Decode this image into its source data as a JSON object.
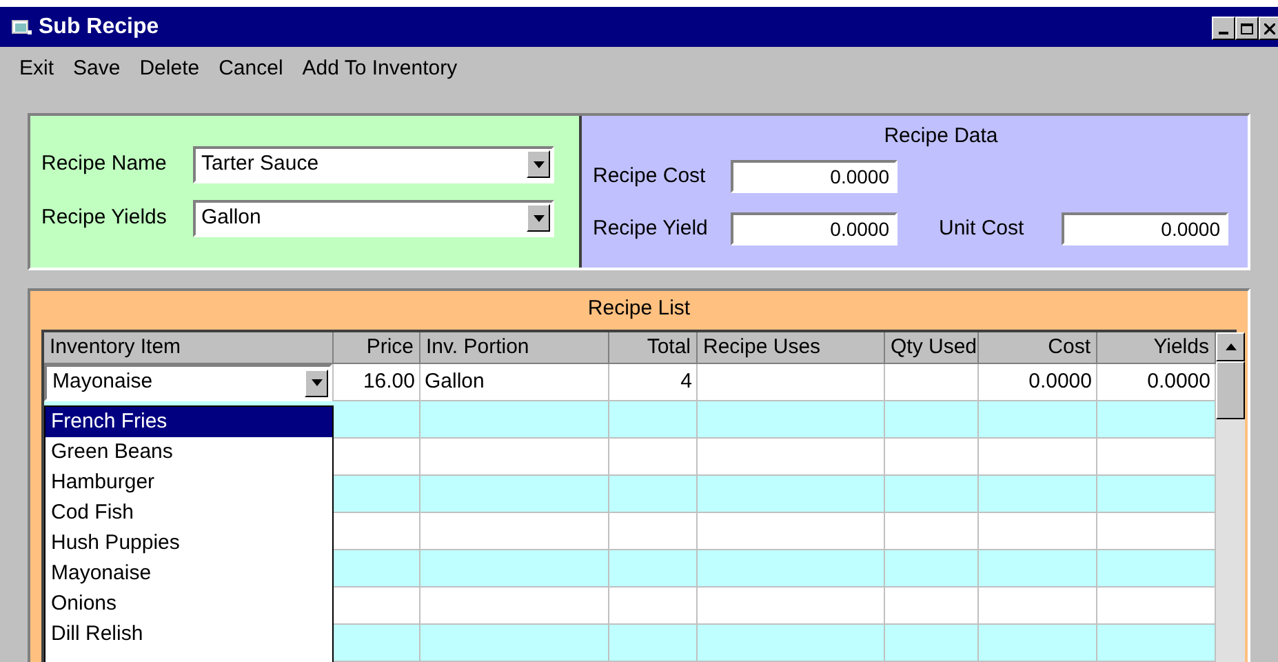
{
  "window": {
    "title": "Sub Recipe"
  },
  "menu": [
    "Exit",
    "Save",
    "Delete",
    "Cancel",
    "Add To Inventory"
  ],
  "recipe": {
    "name_label": "Recipe Name",
    "name_value": "Tarter Sauce",
    "yields_label": "Recipe Yields",
    "yields_value": "Gallon"
  },
  "recipe_data": {
    "title": "Recipe Data",
    "cost_label": "Recipe Cost",
    "cost_value": "0.0000",
    "yield_label": "Recipe Yield",
    "yield_value": "0.0000",
    "unit_cost_label": "Unit Cost",
    "unit_cost_value": "0.0000"
  },
  "recipe_list": {
    "title": "Recipe List",
    "columns": [
      "Inventory Item",
      "Price",
      "Inv. Portion",
      "Total",
      "Recipe Uses",
      "Qty Used",
      "Cost",
      "Yields"
    ],
    "rows": [
      {
        "inventory_item": "Mayonaise",
        "price": "16.00",
        "inv_portion": "Gallon",
        "total": "4",
        "cost": "0.0000",
        "yields": "0.0000"
      }
    ],
    "dropdown": [
      {
        "label": "French Fries",
        "selected": true
      },
      {
        "label": "Green Beans",
        "selected": false
      },
      {
        "label": "Hamburger",
        "selected": false
      },
      {
        "label": "Cod Fish",
        "selected": false
      },
      {
        "label": "Hush Puppies",
        "selected": false
      },
      {
        "label": "Mayonaise",
        "selected": false
      },
      {
        "label": "Onions",
        "selected": false
      },
      {
        "label": "Dill Relish",
        "selected": false
      }
    ]
  }
}
